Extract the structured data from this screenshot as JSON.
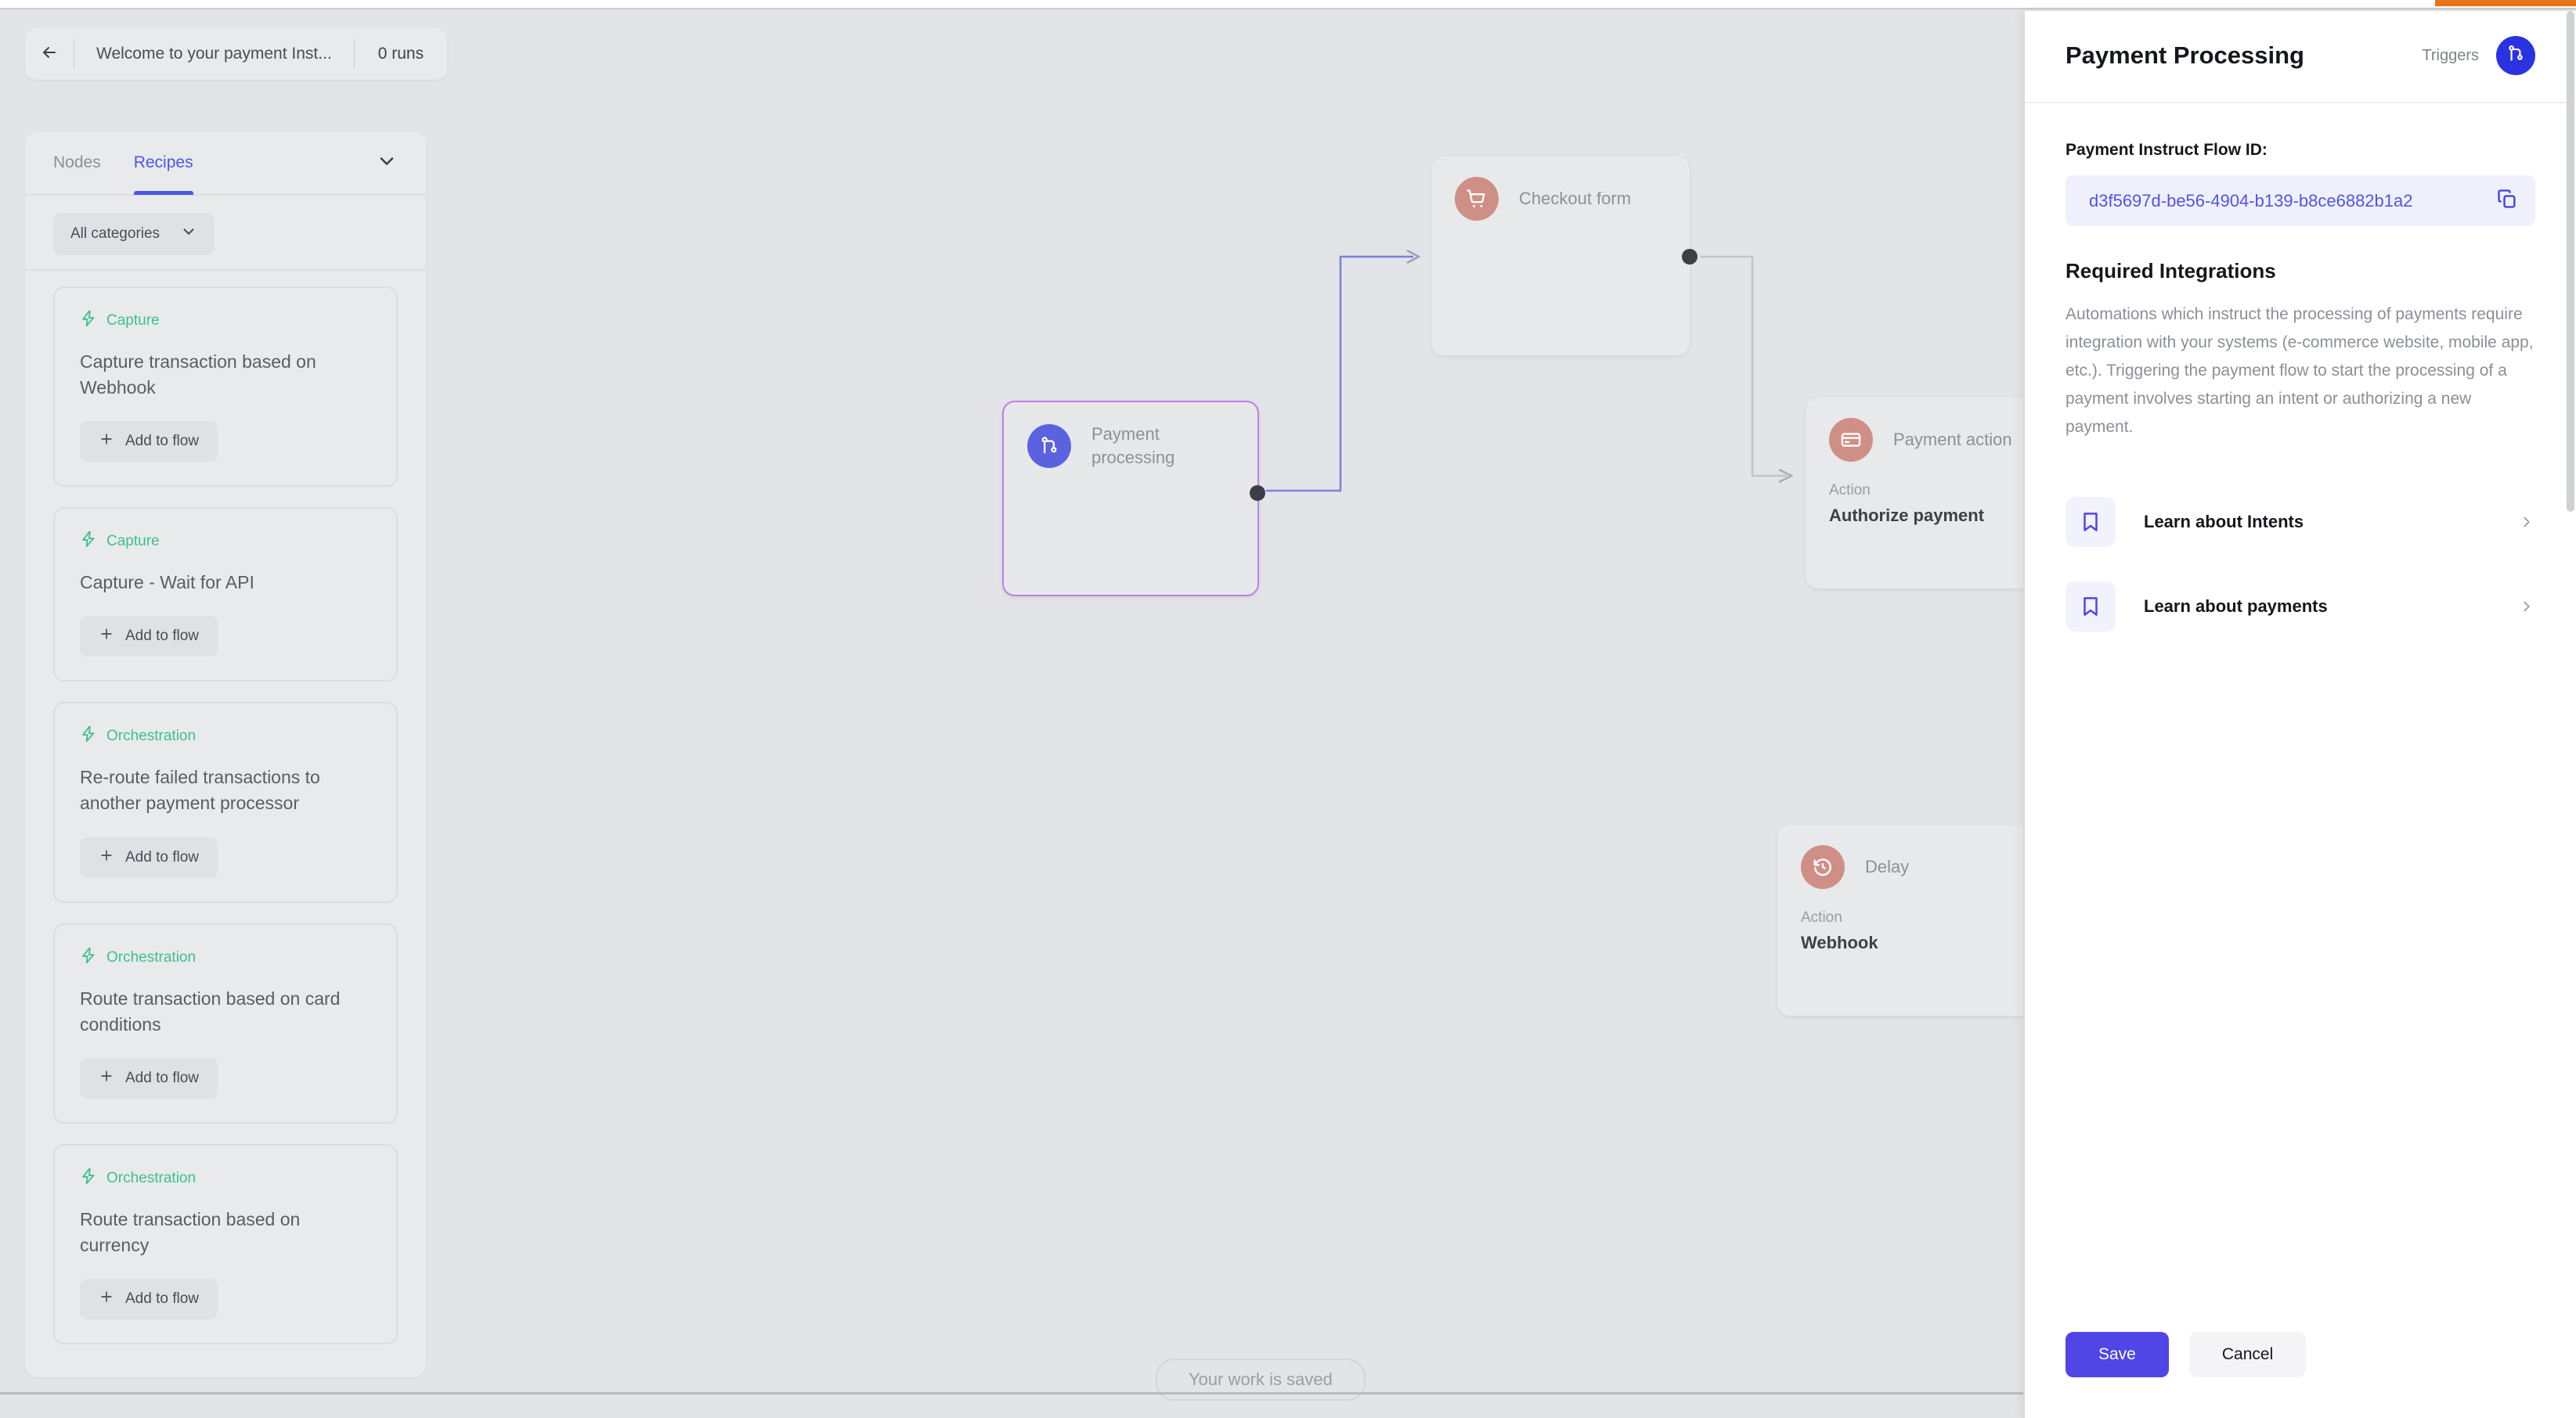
{
  "flow_bar": {
    "back_icon": "arrow-left-icon",
    "title": "Welcome to your payment Inst...",
    "runs": "0 runs"
  },
  "left_panel": {
    "tabs": [
      {
        "label": "Nodes",
        "active": false
      },
      {
        "label": "Recipes",
        "active": true
      }
    ],
    "collapse_icon": "chevron-down-icon",
    "category_filter": {
      "value": "All categories",
      "icon": "chevron-down-icon"
    },
    "add_button_label": "Add to flow",
    "add_button_icon": "plus-icon",
    "category_icon": "lightning-bolt-icon",
    "recipes": [
      {
        "category": "Capture",
        "title": "Capture transaction based on Webhook"
      },
      {
        "category": "Capture",
        "title": "Capture - Wait for API"
      },
      {
        "category": "Orchestration",
        "title": "Re-route failed transactions to another payment processor"
      },
      {
        "category": "Orchestration",
        "title": "Route transaction based on card conditions"
      },
      {
        "category": "Orchestration",
        "title": "Route transaction based on currency"
      }
    ]
  },
  "canvas": {
    "saved_status": "Your work is saved",
    "nodes": [
      {
        "id": "checkout-form",
        "label": "Checkout form",
        "icon": "shopping-cart-icon",
        "icon_color": "#d08f86"
      },
      {
        "id": "payment-processing",
        "label": "Payment processing",
        "icon": "git-branch-icon",
        "icon_color": "#5b62e0",
        "selected": true
      },
      {
        "id": "payment-action",
        "label": "Payment action",
        "icon": "credit-card-icon",
        "icon_color": "#d08f86",
        "field_label": "Action",
        "field_value": "Authorize payment"
      },
      {
        "id": "delay",
        "label": "Delay",
        "icon": "clock-rewind-icon",
        "icon_color": "#d08f86",
        "field_label": "Action",
        "field_value": "Webhook"
      }
    ]
  },
  "side_panel": {
    "title": "Payment Processing",
    "triggers_label": "Triggers",
    "badge_icon": "git-branch-icon",
    "flow_id_label": "Payment Instruct Flow ID:",
    "flow_id_value": "d3f5697d-be56-4904-b139-b8ce6882b1a2",
    "copy_icon": "copy-icon",
    "section_title": "Required Integrations",
    "description": "Automations which instruct the processing of payments require integration with your systems (e-commerce website, mobile app, etc.). Triggering the payment flow to start the processing of a payment involves starting an intent or authorizing a new payment.",
    "learn_items": [
      {
        "label": "Learn about Intents",
        "icon": "bookmark-icon",
        "chevron": "chevron-right-icon"
      },
      {
        "label": "Learn about payments",
        "icon": "bookmark-icon",
        "chevron": "chevron-right-icon"
      }
    ],
    "save_label": "Save",
    "cancel_label": "Cancel"
  },
  "colors": {
    "accent": "#4f55e8",
    "primary_button": "#4f46e5",
    "badge_blue": "#2b33e0",
    "category_green": "#3fc08a",
    "node_rose": "#d08f86",
    "node_blue": "#5b62e0",
    "selected_border": "#c07ee8",
    "canvas_bg": "#e2e4e7",
    "orange_tab": "#e8751a"
  }
}
